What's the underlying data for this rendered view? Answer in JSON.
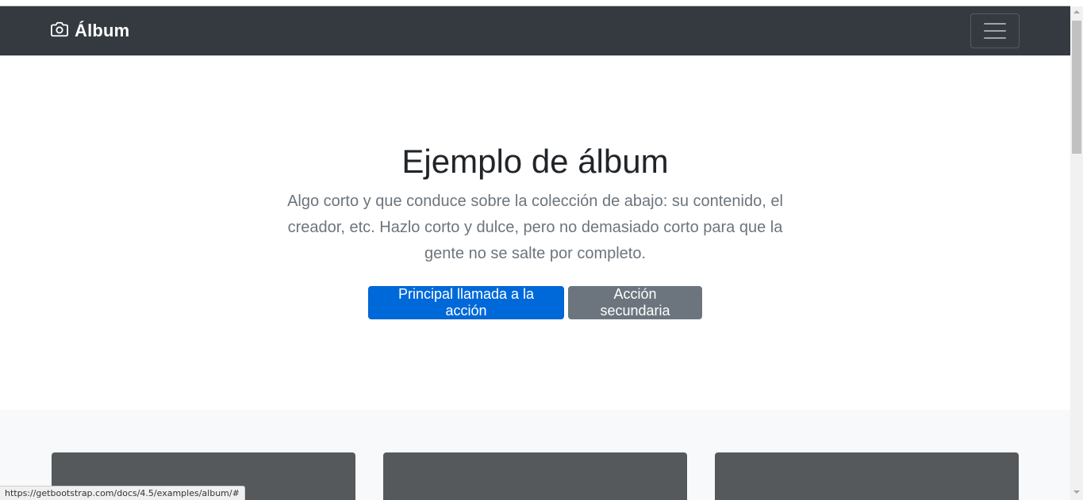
{
  "navbar": {
    "brand_text": "Álbum",
    "brand_icon": "camera-icon",
    "toggler_icon": "hamburger-icon"
  },
  "hero": {
    "title": "Ejemplo de álbum",
    "lead": "Algo corto y que conduce sobre la colección de abajo: su contenido, el creador, etc. Hazlo corto y dulce, pero no demasiado corto para que la gente no se salte por completo.",
    "primary_button": "Principal llamada a la acción",
    "secondary_button": "Acción secundaria"
  },
  "status_bar": {
    "url": "https://getbootstrap.com/docs/4.5/examples/album/#"
  },
  "colors": {
    "navbar_bg": "#343a40",
    "primary": "#0069d9",
    "secondary": "#6c757d",
    "card_bg": "#55595c",
    "album_bg": "#f8f9fa"
  }
}
